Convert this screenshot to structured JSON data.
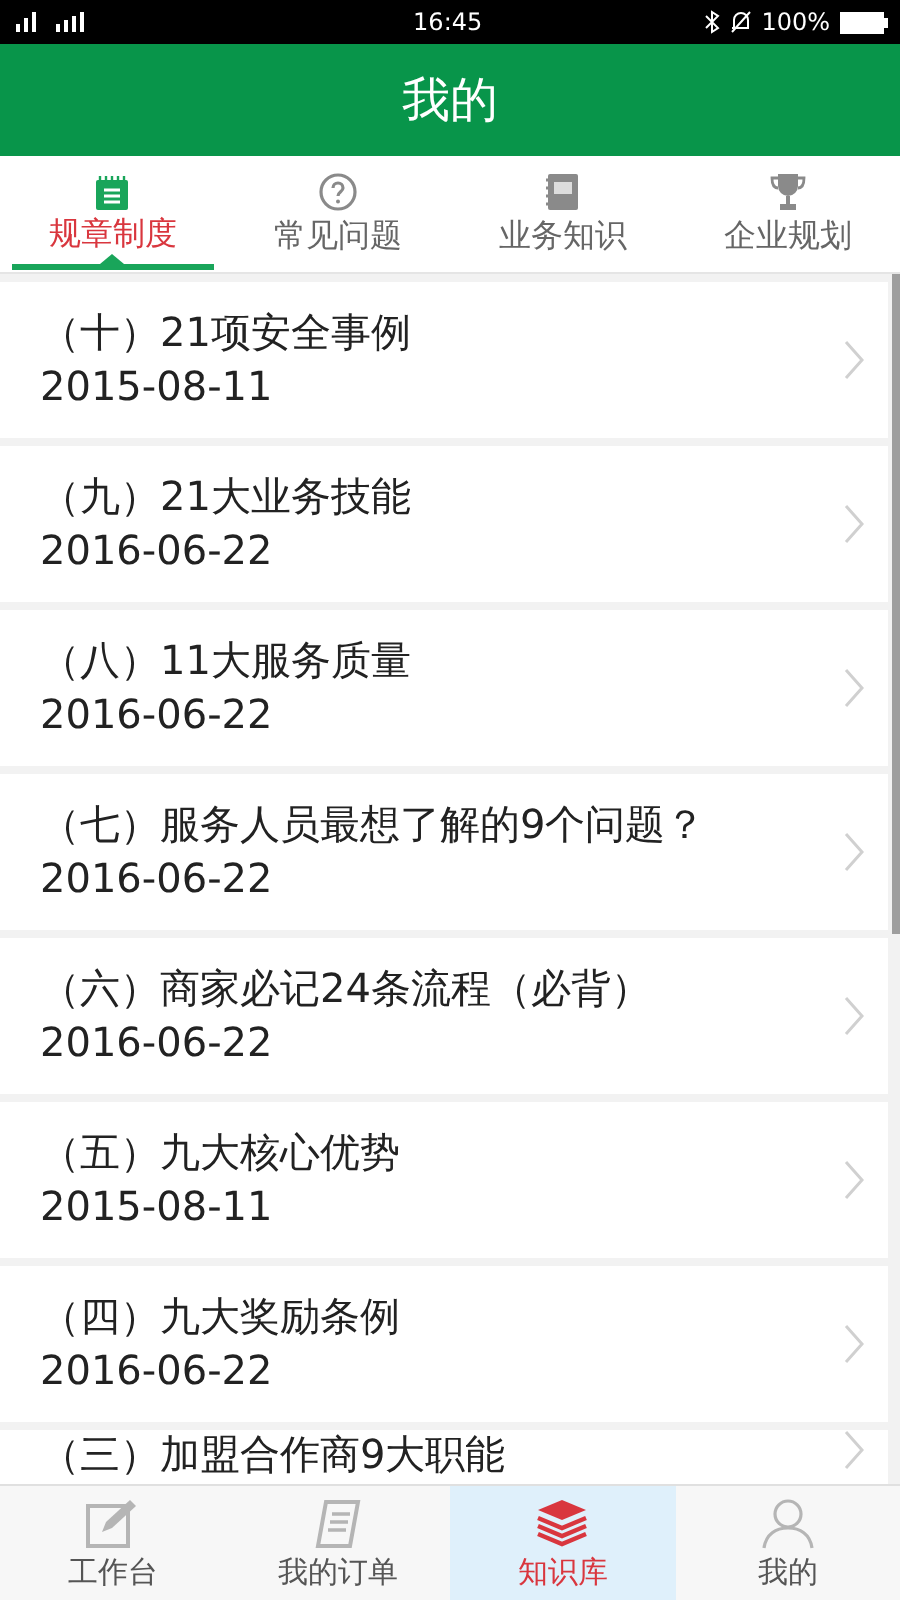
{
  "status_bar": {
    "time": "16:45",
    "battery": "100%"
  },
  "header": {
    "title": "我的"
  },
  "tabs": [
    {
      "label": "规章制度",
      "selected": true,
      "kind": "notepad"
    },
    {
      "label": "常见问题",
      "selected": false,
      "kind": "question"
    },
    {
      "label": "业务知识",
      "selected": false,
      "kind": "book"
    },
    {
      "label": "企业规划",
      "selected": false,
      "kind": "trophy"
    }
  ],
  "items": [
    {
      "title": "（十）21项安全事例",
      "date": "2015-08-11"
    },
    {
      "title": "（九）21大业务技能",
      "date": "2016-06-22"
    },
    {
      "title": "（八）11大服务质量",
      "date": "2016-06-22"
    },
    {
      "title": "（七）服务人员最想了解的9个问题？",
      "date": "2016-06-22"
    },
    {
      "title": "（六）商家必记24条流程（必背）",
      "date": "2016-06-22"
    },
    {
      "title": "（五）九大核心优势",
      "date": "2015-08-11"
    },
    {
      "title": "（四）九大奖励条例",
      "date": "2016-06-22"
    },
    {
      "title": "（三）加盟合作商9大职能"
    }
  ],
  "bottom_nav": [
    {
      "label": "工作台",
      "selected": false,
      "kind": "edit"
    },
    {
      "label": "我的订单",
      "selected": false,
      "kind": "orders"
    },
    {
      "label": "知识库",
      "selected": true,
      "kind": "stack"
    },
    {
      "label": "我的",
      "selected": false,
      "kind": "user"
    }
  ]
}
